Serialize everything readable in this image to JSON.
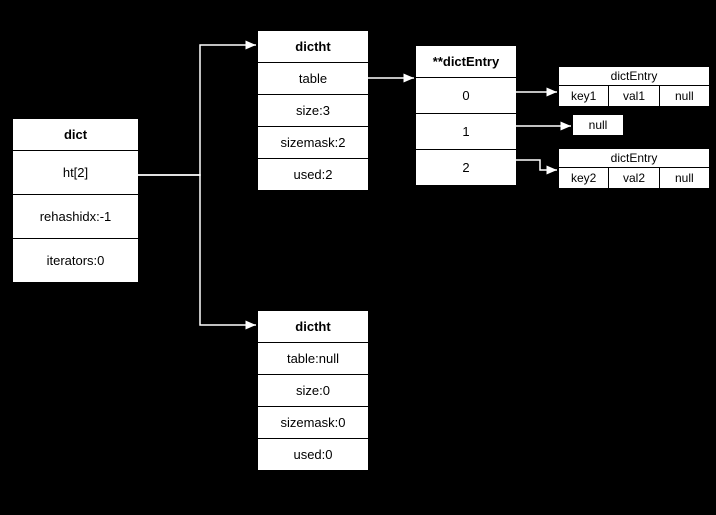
{
  "dict": {
    "title": "dict",
    "ht": "ht[2]",
    "rehashidx": "rehashidx:-1",
    "iterators": "iterators:0"
  },
  "dictht0": {
    "title": "dictht",
    "table": "table",
    "size": "size:3",
    "sizemask": "sizemask:2",
    "used": "used:2"
  },
  "dictht1": {
    "title": "dictht",
    "table": "table:null",
    "size": "size:0",
    "sizemask": "sizemask:0",
    "used": "used:0"
  },
  "buckets": {
    "title": "**dictEntry",
    "b0": "0",
    "b1": "1",
    "b2": "2"
  },
  "entry0": {
    "title": "dictEntry",
    "key": "key1",
    "val": "val1",
    "next": "null"
  },
  "entry2": {
    "title": "dictEntry",
    "key": "key2",
    "val": "val2",
    "next": "null"
  },
  "nullbox": "null"
}
